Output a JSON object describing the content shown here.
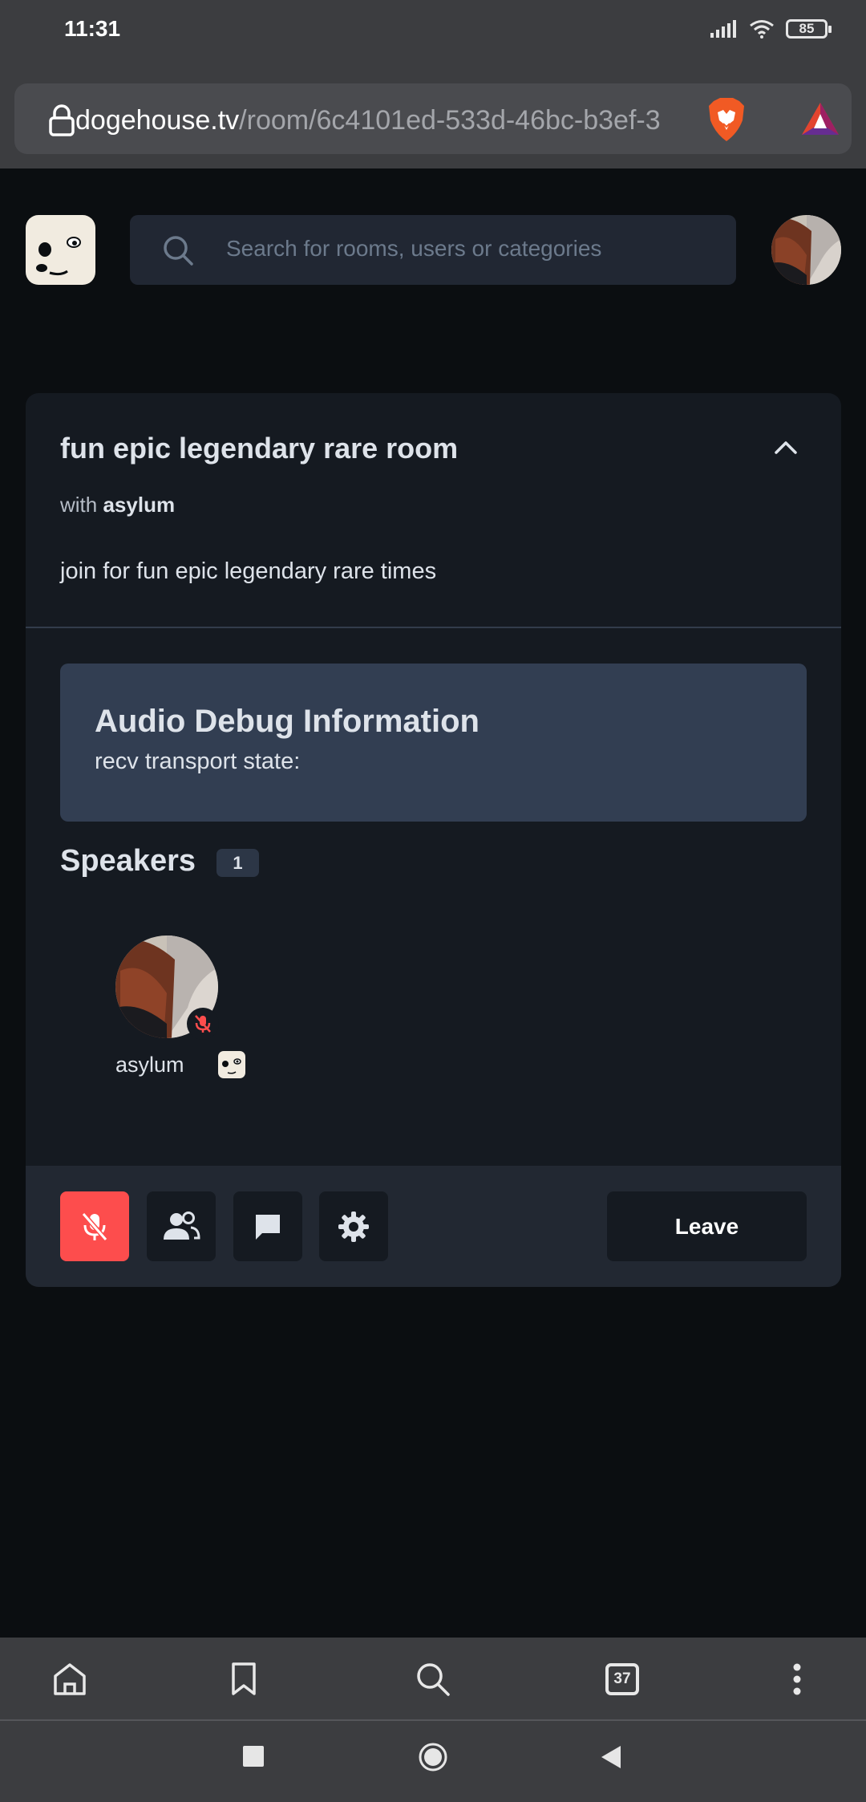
{
  "status_bar": {
    "time": "11:31",
    "battery": "85"
  },
  "browser": {
    "url_host": "dogehouse.tv",
    "url_path": "/room/6c4101ed-533d-46bc-b3ef-3",
    "tabs_count": "37"
  },
  "header": {
    "search_placeholder": "Search for rooms, users or categories"
  },
  "room": {
    "title": "fun epic legendary rare room",
    "with_prefix": "with ",
    "host": "asylum",
    "description": "join for fun epic legendary rare times",
    "debug_title": "Audio Debug Information",
    "debug_state": "recv transport state:",
    "speakers_label": "Speakers",
    "speakers_count": "1",
    "speakers": [
      {
        "name": "asylum",
        "muted": true
      }
    ],
    "leave_label": "Leave"
  },
  "colors": {
    "accent_red": "#fd4d4d",
    "card_bg": "#151a21",
    "page_bg": "#0b0e11"
  }
}
